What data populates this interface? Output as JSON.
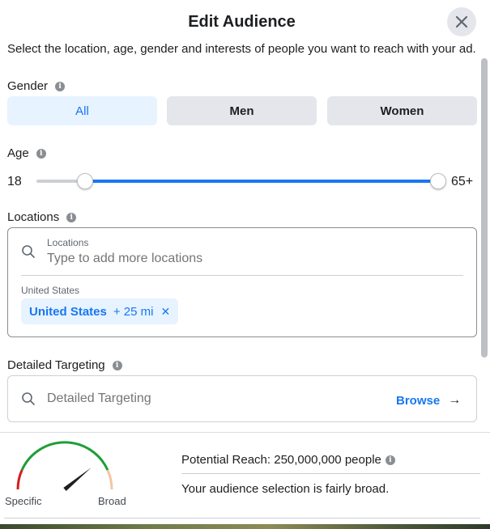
{
  "header": {
    "title": "Edit Audience"
  },
  "intro": "Select the location, age, gender and interests of people you want to reach with your ad.",
  "gender": {
    "label": "Gender",
    "options": [
      "All",
      "Men",
      "Women"
    ],
    "selected": "All"
  },
  "age": {
    "label": "Age",
    "min": "18",
    "max": "65+",
    "range_fraction": [
      0.12,
      1.0
    ]
  },
  "locations": {
    "label": "Locations",
    "search_label": "Locations",
    "placeholder": "Type to add more locations",
    "country": "United States",
    "chip": {
      "name": "United States",
      "radius": "+ 25 mi",
      "remove": "✕"
    }
  },
  "detailed_targeting": {
    "label": "Detailed Targeting",
    "placeholder": "Detailed Targeting",
    "browse": "Browse",
    "arrow": "→"
  },
  "reach": {
    "text": "Potential Reach: 250,000,000 people",
    "description": "Your audience selection is fairly broad.",
    "gauge_specific": "Specific",
    "gauge_broad": "Broad",
    "gauge_level": 0.78,
    "colors": {
      "low": "#d81b1b",
      "mid": "#1e9e36",
      "high": "#f2c6a0"
    }
  },
  "colors": {
    "accent": "#1877f2",
    "selected_bg": "#e7f3ff",
    "button_bg": "#e4e6eb"
  }
}
